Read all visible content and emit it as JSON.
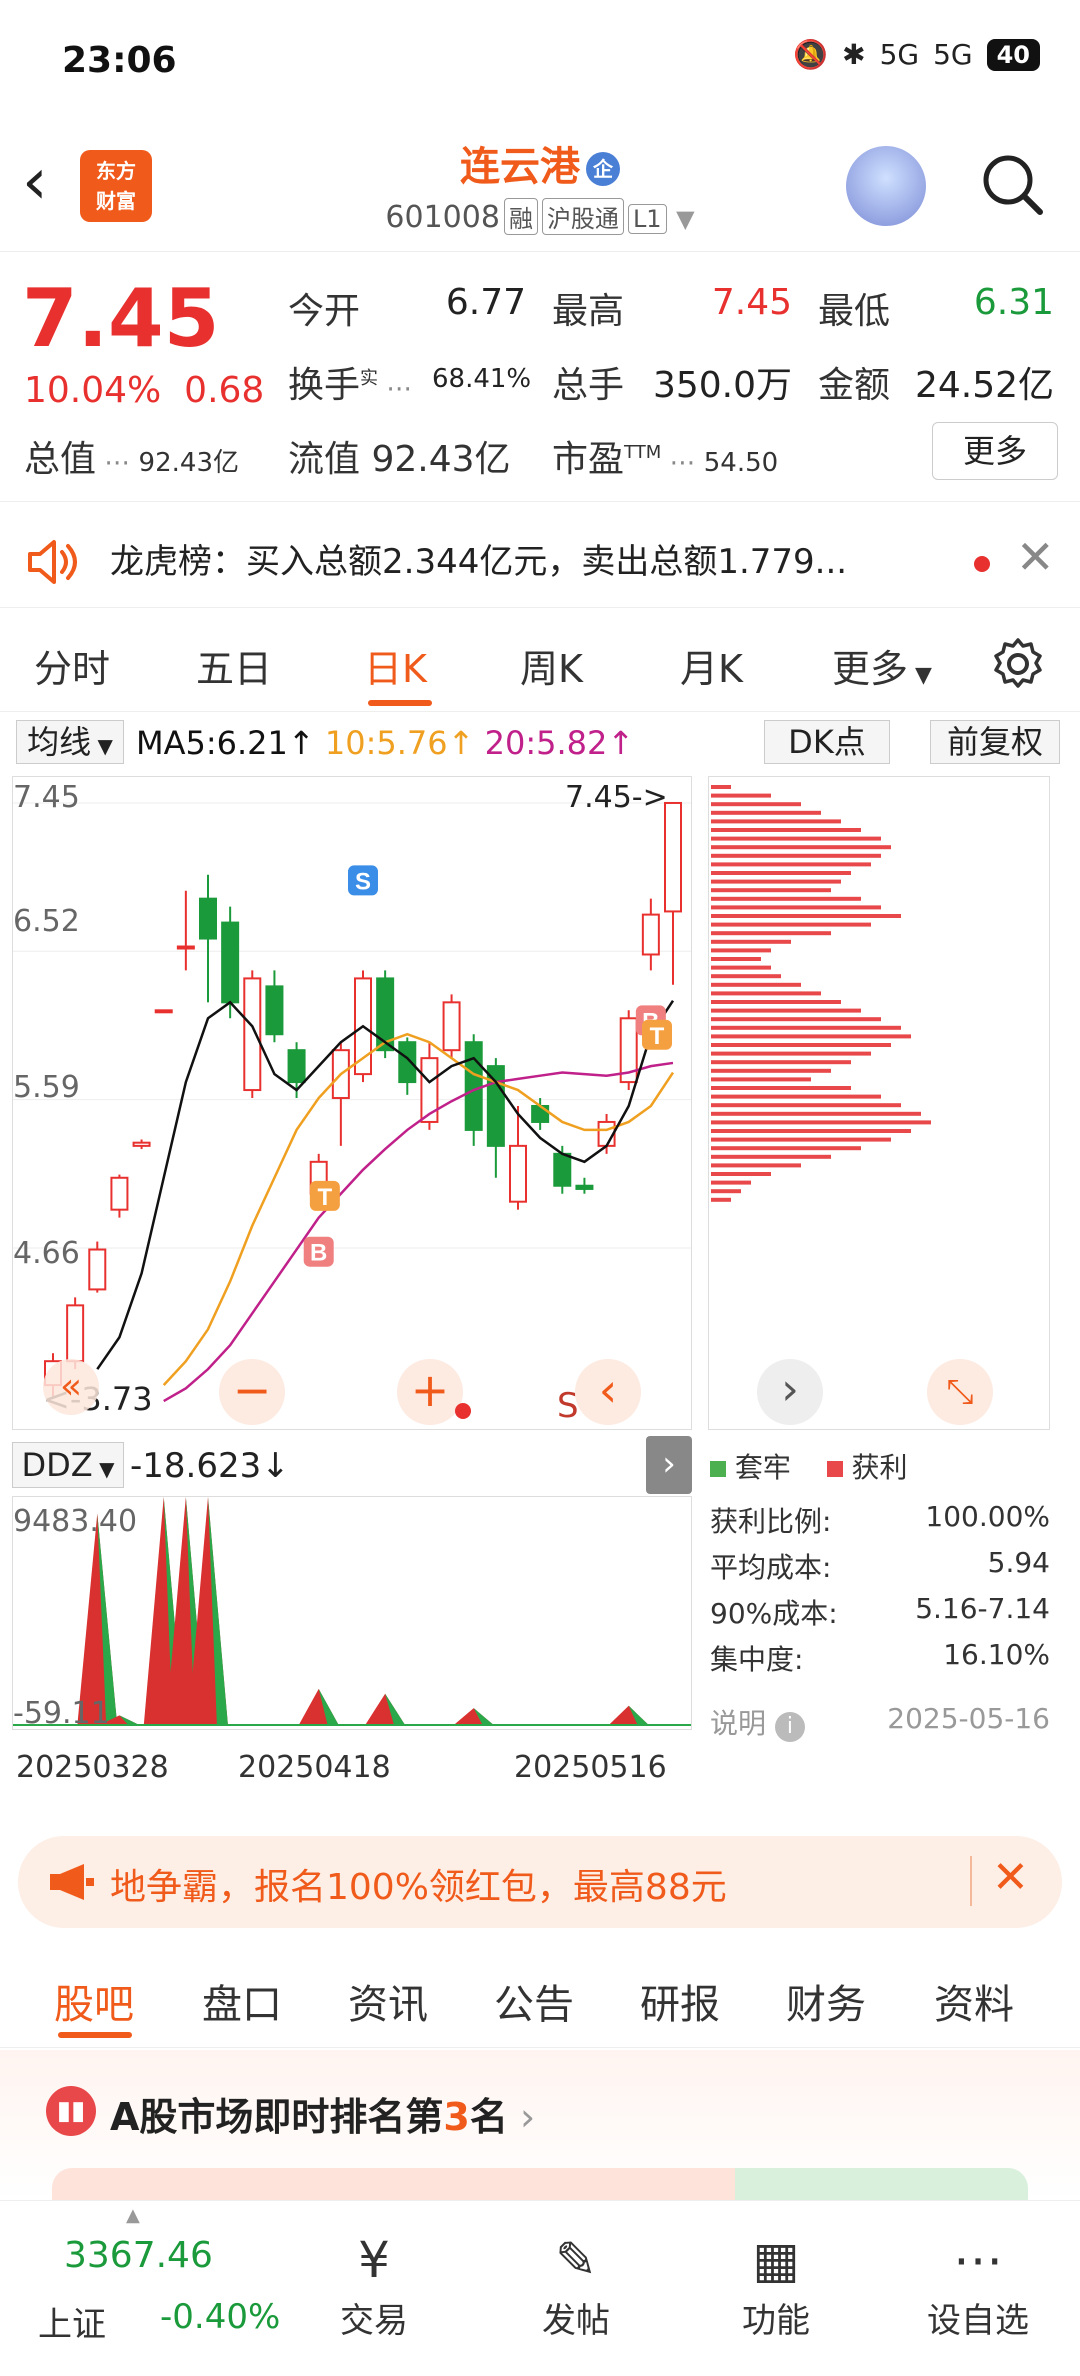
{
  "status": {
    "time": "23:06",
    "battery": "40",
    "signal1": "5G",
    "signal2": "5G"
  },
  "header": {
    "logo_line1": "东方",
    "logo_line2": "财富",
    "stock_name": "连云港",
    "badge": "企",
    "stock_code": "601008",
    "tags": [
      "融",
      "沪股通",
      "L1"
    ]
  },
  "quote": {
    "price": "7.45",
    "change_pct": "10.04%",
    "change": "0.68",
    "open_label": "今开",
    "open": "6.77",
    "high_label": "最高",
    "high": "7.45",
    "low_label": "最低",
    "low": "6.31",
    "turnover_label": "换手",
    "turnover_sup": "实",
    "turnover": "68.41%",
    "volume_label": "总手",
    "volume": "350.0万",
    "amount_label": "金额",
    "amount": "24.52亿",
    "mktcap_label": "总值",
    "mktcap": "92.43亿",
    "float_label": "流值",
    "float_cap": "92.43亿",
    "pe_label": "市盈",
    "pe_sup": "TTM",
    "pe": "54.50",
    "more": "更多"
  },
  "notice": {
    "text": "龙虎榜：买入总额2.344亿元，卖出总额1.779..."
  },
  "chart_tabs": [
    "分时",
    "五日",
    "日K",
    "周K",
    "月K",
    "更多"
  ],
  "active_chart_tab": "日K",
  "ma": {
    "selector": "均线",
    "ma5": "MA5:6.21",
    "ma10": "10:5.76",
    "ma20": "20:5.82",
    "dk": "DK点",
    "adjust": "前复权",
    "ma5_color": "#111111",
    "ma10_color": "#f0a020",
    "ma20_color": "#c0208a"
  },
  "chart_data": [
    {
      "type": "candlestick",
      "y_ticks": [
        "7.45",
        "6.52",
        "5.59",
        "4.66"
      ],
      "ylim": [
        3.6,
        7.5
      ],
      "last_price_label": "7.45->",
      "low_label": "<-3.73",
      "x_labels": [
        "20250328",
        "20250418",
        "20250516"
      ],
      "candles": [
        {
          "o": 3.8,
          "c": 3.95,
          "h": 4.0,
          "l": 3.73
        },
        {
          "o": 3.95,
          "c": 4.3,
          "h": 4.35,
          "l": 3.9
        },
        {
          "o": 4.4,
          "c": 4.65,
          "h": 4.7,
          "l": 4.38
        },
        {
          "o": 4.9,
          "c": 5.1,
          "h": 5.12,
          "l": 4.85
        },
        {
          "o": 5.3,
          "c": 5.32,
          "h": 5.34,
          "l": 5.28
        },
        {
          "o": 6.15,
          "c": 6.15,
          "h": 6.15,
          "l": 6.15
        },
        {
          "o": 6.55,
          "c": 6.55,
          "h": 6.9,
          "l": 6.4
        },
        {
          "o": 6.85,
          "c": 6.6,
          "h": 7.0,
          "l": 6.2
        },
        {
          "o": 6.7,
          "c": 6.2,
          "h": 6.8,
          "l": 6.1
        },
        {
          "o": 5.65,
          "c": 6.35,
          "h": 6.4,
          "l": 5.6
        },
        {
          "o": 6.3,
          "c": 6.0,
          "h": 6.4,
          "l": 5.95
        },
        {
          "o": 5.9,
          "c": 5.7,
          "h": 5.95,
          "l": 5.6
        },
        {
          "o": 5.0,
          "c": 5.2,
          "h": 5.25,
          "l": 4.95
        },
        {
          "o": 5.6,
          "c": 5.9,
          "h": 5.95,
          "l": 5.3
        },
        {
          "o": 5.75,
          "c": 6.35,
          "h": 6.4,
          "l": 5.7
        },
        {
          "o": 6.35,
          "c": 5.9,
          "h": 6.4,
          "l": 5.85
        },
        {
          "o": 5.95,
          "c": 5.7,
          "h": 5.98,
          "l": 5.62
        },
        {
          "o": 5.45,
          "c": 5.85,
          "h": 5.95,
          "l": 5.4
        },
        {
          "o": 5.9,
          "c": 6.2,
          "h": 6.25,
          "l": 5.85
        },
        {
          "o": 5.95,
          "c": 5.4,
          "h": 6.0,
          "l": 5.3
        },
        {
          "o": 5.8,
          "c": 5.3,
          "h": 5.85,
          "l": 5.1
        },
        {
          "o": 4.95,
          "c": 5.3,
          "h": 5.55,
          "l": 4.9
        },
        {
          "o": 5.55,
          "c": 5.45,
          "h": 5.6,
          "l": 5.4
        },
        {
          "o": 5.25,
          "c": 5.05,
          "h": 5.3,
          "l": 5.0
        },
        {
          "o": 5.05,
          "c": 5.03,
          "h": 5.1,
          "l": 5.0
        },
        {
          "o": 5.3,
          "c": 5.45,
          "h": 5.5,
          "l": 5.25
        },
        {
          "o": 5.7,
          "c": 6.1,
          "h": 6.15,
          "l": 5.65
        },
        {
          "o": 6.5,
          "c": 6.75,
          "h": 6.85,
          "l": 6.4
        },
        {
          "o": 6.77,
          "c": 7.45,
          "h": 7.45,
          "l": 6.31
        }
      ],
      "ma5": [
        3.9,
        4.1,
        4.5,
        5.1,
        5.7,
        6.1,
        6.2,
        6.05,
        5.75,
        5.65,
        5.8,
        5.95,
        6.05,
        5.95,
        5.85,
        5.7,
        5.8,
        5.85,
        5.7,
        5.5,
        5.35,
        5.25,
        5.2,
        5.3,
        5.55,
        6.0,
        6.21
      ],
      "ma10": [
        3.8,
        3.95,
        4.15,
        4.45,
        4.8,
        5.1,
        5.4,
        5.6,
        5.75,
        5.85,
        5.95,
        6.0,
        5.95,
        5.85,
        5.75,
        5.7,
        5.65,
        5.55,
        5.45,
        5.4,
        5.4,
        5.45,
        5.55,
        5.76
      ],
      "ma20": [
        3.7,
        3.78,
        3.9,
        4.05,
        4.25,
        4.45,
        4.65,
        4.85,
        5.0,
        5.15,
        5.28,
        5.4,
        5.5,
        5.58,
        5.65,
        5.7,
        5.72,
        5.74,
        5.76,
        5.75,
        5.74,
        5.76,
        5.8,
        5.82
      ],
      "markers": [
        {
          "label": "S",
          "candle": 14,
          "color": "#3b8ee8"
        },
        {
          "label": "B",
          "candle": 12,
          "color": "#f08080"
        },
        {
          "label": "T",
          "candle": 13,
          "color": "#f5a040"
        },
        {
          "label": "B",
          "candle": 27,
          "color": "#f08080"
        },
        {
          "label": "T",
          "candle": 28,
          "color": "#f5a040"
        }
      ]
    },
    {
      "type": "area",
      "name": "DDZ",
      "value_label": "-18.623",
      "y_ticks": [
        "9483.40",
        "-59.11"
      ],
      "ylim": [
        -59.11,
        9483.4
      ],
      "values": [
        0,
        0,
        8800,
        400,
        0,
        9483,
        9483,
        9483,
        0,
        0,
        0,
        0,
        1500,
        0,
        0,
        1300,
        0,
        0,
        0,
        700,
        0,
        0,
        0,
        0,
        0,
        0,
        800,
        0,
        0
      ]
    }
  ],
  "chart_controls": {
    "prev": "«",
    "minus": "−",
    "plus": "+",
    "back": "‹",
    "fwd": "›",
    "s_label": "S"
  },
  "chip_legend": {
    "trapped": "套牢",
    "profit": "获利",
    "trapped_color": "#4cb050",
    "profit_color": "#e8484a"
  },
  "chip_info": {
    "profit_ratio_label": "获利比例:",
    "profit_ratio": "100.00%",
    "avg_cost_label": "平均成本:",
    "avg_cost": "5.94",
    "cost90_label": "90%成本:",
    "cost90": "5.16-7.14",
    "concentration_label": "集中度:",
    "concentration": "16.10%",
    "explain": "说明",
    "date": "2025-05-16"
  },
  "banner": {
    "text": "地争霸，报名100%领红包，最高88元"
  },
  "bottom_tabs": [
    "股吧",
    "盘口",
    "资讯",
    "公告",
    "研报",
    "财务",
    "资料"
  ],
  "active_bottom_tab": "股吧",
  "ranking": {
    "text_pre": "A股市场即时排名第",
    "rank": "3",
    "text_post": "名"
  },
  "index": {
    "value": "3367.46",
    "name": "上证",
    "change": "-0.40%"
  },
  "bottom_nav": [
    {
      "label": "交易",
      "icon": "trade-icon"
    },
    {
      "label": "发帖",
      "icon": "post-icon"
    },
    {
      "label": "功能",
      "icon": "grid-icon"
    },
    {
      "label": "设自选",
      "icon": "more-icon"
    }
  ]
}
